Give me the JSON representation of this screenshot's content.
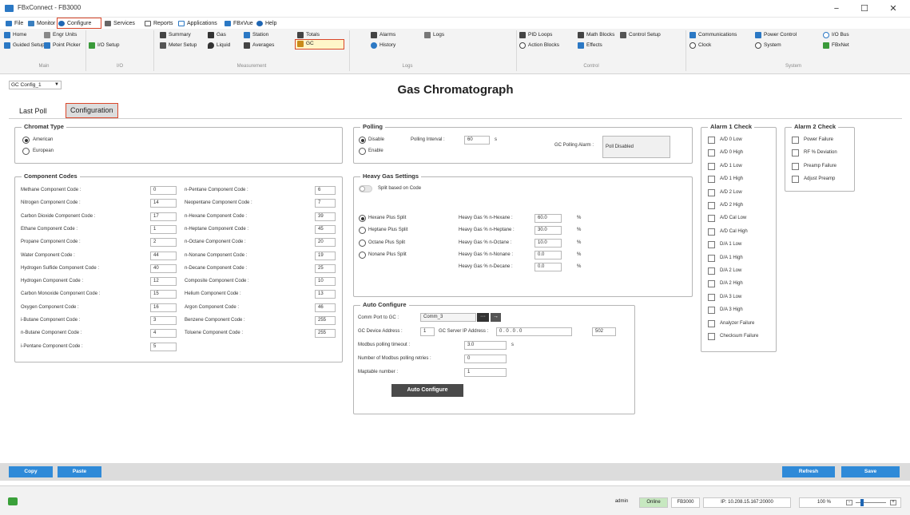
{
  "window": {
    "title": "FBxConnect - FB3000",
    "minimize": "−",
    "maximize": "☐",
    "close": "✕"
  },
  "menubar": [
    {
      "label": "File",
      "icon": "file-icon"
    },
    {
      "label": "Monitor",
      "icon": "monitor-icon"
    },
    {
      "label": "Configure",
      "icon": "configure-icon"
    },
    {
      "label": "Services",
      "icon": "services-icon"
    },
    {
      "label": "Reports",
      "icon": "reports-icon"
    },
    {
      "label": "Applications",
      "icon": "applications-icon"
    },
    {
      "label": "FBxVue",
      "icon": "fbxvue-icon"
    },
    {
      "label": "Help",
      "icon": "help-icon"
    }
  ],
  "ribbon": {
    "main": {
      "home": "Home",
      "engr_units": "Engr Units",
      "guided_setup": "Guided Setup",
      "point_picker": "Point Picker",
      "group": "Main"
    },
    "io": {
      "io_setup": "I/O Setup",
      "group": "I/O"
    },
    "measurement": {
      "summary": "Summary",
      "meter_setup": "Meter Setup",
      "gas": "Gas",
      "liquid": "Liquid",
      "station": "Station",
      "averages": "Averages",
      "totals": "Totals",
      "gc": "GC",
      "group": "Measurement"
    },
    "logs": {
      "alarms": "Alarms",
      "history": "History",
      "logs": "Logs",
      "group": "Logs"
    },
    "control": {
      "pid_loops": "PID Loops",
      "action_blocks": "Action Blocks",
      "math_blocks": "Math Blocks",
      "effects": "Effects",
      "control_setup": "Control Setup",
      "group": "Control"
    },
    "system": {
      "communications": "Communications",
      "clock": "Clock",
      "power_control": "Power Control",
      "system": "System",
      "io_bus": "I/O Bus",
      "fbxnet": "FBxNet",
      "group": "System"
    }
  },
  "config_select": "GC Config_1",
  "page_title": "Gas Chromatograph",
  "tabs": {
    "last_poll": "Last Poll",
    "configuration": "Configuration"
  },
  "chromat_type": {
    "title": "Chromat Type",
    "options": [
      {
        "label": "American",
        "selected": true
      },
      {
        "label": "European",
        "selected": false
      }
    ]
  },
  "component_codes": {
    "title": "Component Codes",
    "left": [
      {
        "label": "Methane Component Code :",
        "value": "0"
      },
      {
        "label": "Nitrogen Component Code :",
        "value": "14"
      },
      {
        "label": "Carbon Dioxide Component Code :",
        "value": "17"
      },
      {
        "label": "Ethane Component Code :",
        "value": "1"
      },
      {
        "label": "Propane Component Code :",
        "value": "2"
      },
      {
        "label": "Water Component Code :",
        "value": "44"
      },
      {
        "label": "Hydrogen Sulfide Component Code :",
        "value": "40"
      },
      {
        "label": "Hydrogen Component Code :",
        "value": "12"
      },
      {
        "label": "Carbon Monoxide Component Code :",
        "value": "15"
      },
      {
        "label": "Oxygen Component Code :",
        "value": "16"
      },
      {
        "label": "i-Butane Component Code :",
        "value": "3"
      },
      {
        "label": "n-Butane Component Code :",
        "value": "4"
      },
      {
        "label": "i-Pentane Component Code :",
        "value": "5"
      }
    ],
    "right": [
      {
        "label": "n-Pentane Component Code :",
        "value": "6"
      },
      {
        "label": "Neopentane Component Code :",
        "value": "7"
      },
      {
        "label": "n-Hexane Component Code :",
        "value": "39"
      },
      {
        "label": "n-Heptane Component Code :",
        "value": "45"
      },
      {
        "label": "n-Octane Component Code :",
        "value": "20"
      },
      {
        "label": "n-Nonane Component Code :",
        "value": "19"
      },
      {
        "label": "n-Decane Component Code :",
        "value": "25"
      },
      {
        "label": "Composite Component Code :",
        "value": "10"
      },
      {
        "label": "Helium Component Code :",
        "value": "13"
      },
      {
        "label": "Argon Component Code :",
        "value": "46"
      },
      {
        "label": "Benzene Component Code :",
        "value": "255"
      },
      {
        "label": "Toluene Component Code :",
        "value": "255"
      }
    ]
  },
  "polling": {
    "title": "Polling",
    "disable": "Disable",
    "enable": "Enable",
    "interval_label": "Polling Interval :",
    "interval_value": "60",
    "interval_unit": "s",
    "alarm_label": "GC Polling Alarm :",
    "alarm_value": "Poll Disabled"
  },
  "heavy_gas": {
    "title": "Heavy Gas Settings",
    "split_toggle": "Split based on Code",
    "options": [
      {
        "label": "Hexane Plus Split",
        "selected": true
      },
      {
        "label": "Heptane Plus Split",
        "selected": false
      },
      {
        "label": "Octane Plus Split",
        "selected": false
      },
      {
        "label": "Nonane Plus Split",
        "selected": false
      }
    ],
    "percents": [
      {
        "label": "Heavy Gas % n-Hexane :",
        "value": "60.0",
        "unit": "%"
      },
      {
        "label": "Heavy Gas % n-Heptane :",
        "value": "30.0",
        "unit": "%"
      },
      {
        "label": "Heavy Gas % n-Octane :",
        "value": "10.0",
        "unit": "%"
      },
      {
        "label": "Heavy Gas % n-Nonane :",
        "value": "0.0",
        "unit": "%"
      },
      {
        "label": "Heavy Gas % n-Decane :",
        "value": "0.0",
        "unit": "%"
      }
    ]
  },
  "auto_configure": {
    "title": "Auto Configure",
    "comm_port_label": "Comm Port to GC :",
    "comm_port_value": "Comm_3",
    "more_button": "···",
    "go_button": "→",
    "device_address_label": "GC Device Address :",
    "device_address_value": "1",
    "server_ip_label": "GC Server IP Address :",
    "server_ip_value": "0 . 0 . 0 . 0",
    "port_value": "502",
    "timeout_label": "Modbus polling timeout :",
    "timeout_value": "3.0",
    "timeout_unit": "s",
    "retries_label": "Number of Modbus polling retries :",
    "retries_value": "0",
    "maptable_label": "Maptable number :",
    "maptable_value": "1",
    "button": "Auto Configure"
  },
  "alarm1": {
    "title": "Alarm 1 Check",
    "items": [
      "A/D 0 Low",
      "A/D 0 High",
      "A/D 1 Low",
      "A/D 1 High",
      "A/D 2 Low",
      "A/D 2 High",
      "A/D Cal Low",
      "A/D Cal High",
      "D/A 1 Low",
      "D/A 1 High",
      "D/A 2 Low",
      "D/A 2 High",
      "D/A 3 Low",
      "D/A 3 High",
      "Analyzer Failure",
      "Checksum Failure"
    ]
  },
  "alarm2": {
    "title": "Alarm 2 Check",
    "items": [
      "Power Failure",
      "RF % Deviation",
      "Preamp Failure",
      "Adjust Preamp"
    ]
  },
  "bottom": {
    "copy": "Copy",
    "paste": "Paste",
    "refresh": "Refresh",
    "save": "Save"
  },
  "status": {
    "user": "admin",
    "online": "Online",
    "device": "FB3000",
    "ip": "IP: 10.208.15.167:20000",
    "zoom": "100 %"
  },
  "colors": {
    "accent": "#2f8ad8",
    "highlight": "#d9472b",
    "online": "#c7e8c0"
  }
}
